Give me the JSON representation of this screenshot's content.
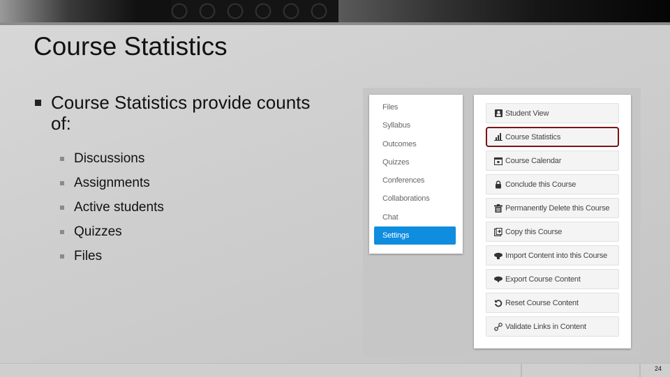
{
  "slide": {
    "title": "Course Statistics",
    "bullet": "Course Statistics provide counts of:",
    "subbullets": [
      "Discussions",
      "Assignments",
      "Active students",
      "Quizzes",
      "Files"
    ],
    "page_number": "24"
  },
  "screenshot": {
    "nav": {
      "items": [
        "Files",
        "Syllabus",
        "Outcomes",
        "Quizzes",
        "Conferences",
        "Collaborations",
        "Chat",
        "Settings"
      ],
      "active": "Settings",
      "active_color": "#0f8ddf"
    },
    "sidebar_buttons": [
      {
        "label": "Student View",
        "icon": "student-view-icon"
      },
      {
        "label": "Course Statistics",
        "icon": "bar-chart-icon",
        "highlighted": true
      },
      {
        "label": "Course Calendar",
        "icon": "calendar-icon"
      },
      {
        "label": "Conclude this Course",
        "icon": "lock-icon"
      },
      {
        "label": "Permanently Delete this Course",
        "icon": "trash-icon"
      },
      {
        "label": "Copy this Course",
        "icon": "copy-icon"
      },
      {
        "label": "Import Content into this Course",
        "icon": "cloud-upload-icon"
      },
      {
        "label": "Export Course Content",
        "icon": "cloud-download-icon"
      },
      {
        "label": "Reset Course Content",
        "icon": "reset-icon"
      },
      {
        "label": "Validate Links in Content",
        "icon": "link-icon"
      }
    ],
    "highlight_color": "#7a1218"
  }
}
